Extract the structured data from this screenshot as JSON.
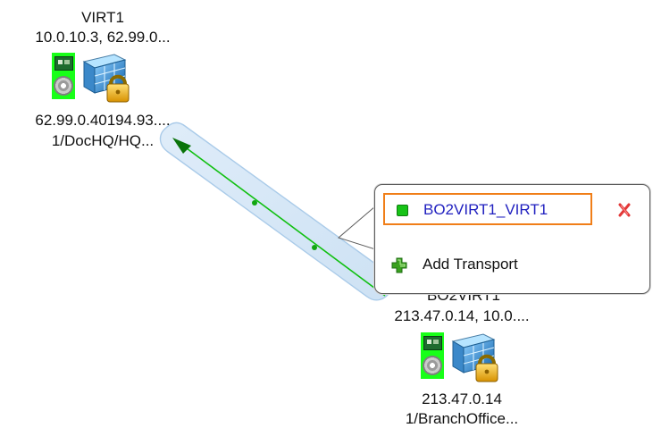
{
  "nodes": [
    {
      "name": "VIRT1",
      "addresses": "10.0.10.3, 62.99.0...",
      "ip": "62.99.0.40194.93....",
      "path": "1/DocHQ/HQ..."
    },
    {
      "name": "BO2VIRT1",
      "addresses": "213.47.0.14, 10.0....",
      "ip": "213.47.0.14",
      "path": "1/BranchOffice..."
    }
  ],
  "popup": {
    "transport_label": "BO2VIRT1_VIRT1",
    "add_label": "Add Transport",
    "status_color": "#17c317"
  },
  "icons": {
    "network": "network-card-icon",
    "firewall": "firewall-lock-icon",
    "remove": "remove-x-icon",
    "add": "add-plus-icon"
  }
}
